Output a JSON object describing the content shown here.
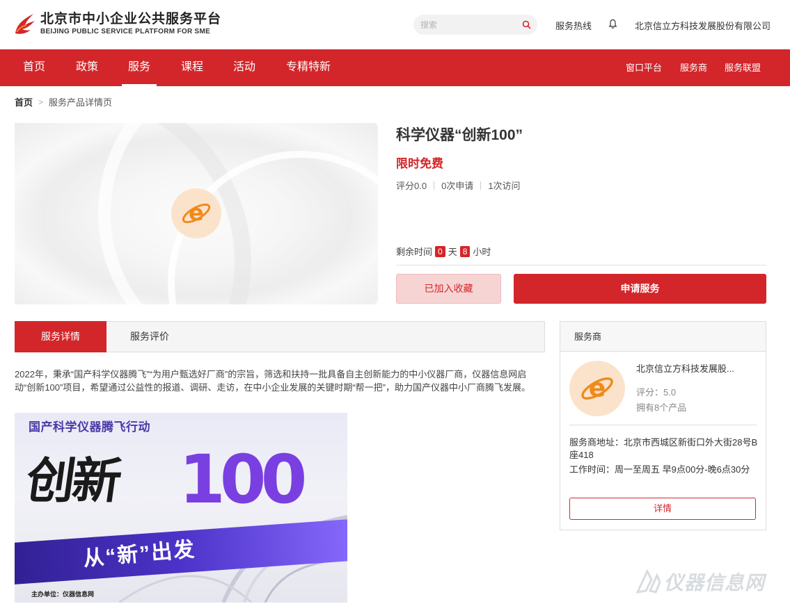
{
  "header": {
    "logo_cn": "北京市中小企业公共服务平台",
    "logo_en": "BEIJING PUBLIC SERVICE PLATFORM FOR SME",
    "search_placeholder": "搜索",
    "hotline": "服务热线",
    "company": "北京信立方科技发展股份有限公司"
  },
  "nav": {
    "items": [
      "首页",
      "政策",
      "服务",
      "课程",
      "活动",
      "专精特新"
    ],
    "active": "服务",
    "right": [
      "窗口平台",
      "服务商",
      "服务联盟"
    ]
  },
  "breadcrumb": {
    "home": "首页",
    "sep": ">",
    "current": "服务产品详情页"
  },
  "product": {
    "title": "科学仪器“创新100”",
    "price": "限时免费",
    "rating": "评分0.0",
    "applications": "0次申请",
    "visits": "1次访问",
    "remain_label": "剩余时间",
    "days": "0",
    "days_unit": "天",
    "hours": "8",
    "hours_unit": "小时",
    "fav_button": "已加入收藏",
    "apply_button": "申请服务"
  },
  "tabs": {
    "detail": "服务详情",
    "review": "服务评价"
  },
  "description": "2022年，秉承“国产科学仪器腾飞”“为用户甄选好厂商”的宗旨，筛选和扶持一批具备自主创新能力的中小仪器厂商，仪器信息网启动“创新100”项目，希望通过公益性的报道、调研、走访，在中小企业发展的关键时期“帮一把”，助力国产仪器中小厂商腾飞发展。",
  "poster": {
    "top": "国产科学仪器腾飞行动",
    "main_cn": "创新",
    "main_num": "100",
    "slogan": "从“新”出发",
    "host": "主办单位：仪器信息网"
  },
  "provider": {
    "header": "服务商",
    "name": "北京信立方科技发展股...",
    "score": "评分：5.0",
    "products": "拥有8个产品",
    "address": "服务商地址：北京市西城区新街口外大街28号B座418",
    "hours": "工作时间：周一至周五 早9点00分-晚6点30分",
    "detail_button": "详情"
  },
  "watermark": "仪器信息网",
  "colors": {
    "brand_red": "#d3262a",
    "ie_orange": "#f08a1c"
  }
}
